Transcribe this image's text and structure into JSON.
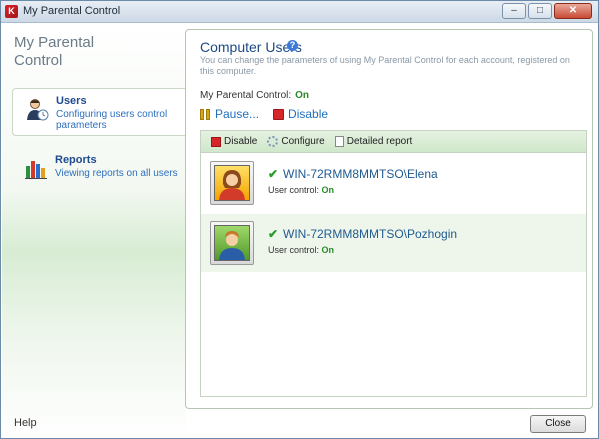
{
  "window": {
    "title": "My Parental Control"
  },
  "sidebar": {
    "title": "My Parental Control",
    "items": [
      {
        "label": "Users",
        "description": "Configuring users control parameters",
        "icon": "users-icon"
      },
      {
        "label": "Reports",
        "description": "Viewing reports on all users",
        "icon": "reports-chart-icon"
      }
    ],
    "help": "Help"
  },
  "main": {
    "title": "Computer Users",
    "description": "You can change the parameters of using My Parental Control for each account, registered on this computer.",
    "status_label": "My Parental Control:",
    "status_value": "On",
    "actions": {
      "pause": "Pause...",
      "disable": "Disable"
    },
    "toolbar": {
      "disable": "Disable",
      "configure": "Configure",
      "report": "Detailed report"
    },
    "users": [
      {
        "name": "WIN-72RMM8MMTSO\\Elena",
        "control_label": "User control:",
        "control_value": "On",
        "avatar": "female"
      },
      {
        "name": "WIN-72RMM8MMTSO\\Pozhogin",
        "control_label": "User control:",
        "control_value": "On",
        "avatar": "male"
      }
    ]
  },
  "footer": {
    "close": "Close"
  },
  "colors": {
    "accent": "#1f6fbf",
    "on": "#2a8a2a",
    "highlight": "#eef6ec"
  }
}
